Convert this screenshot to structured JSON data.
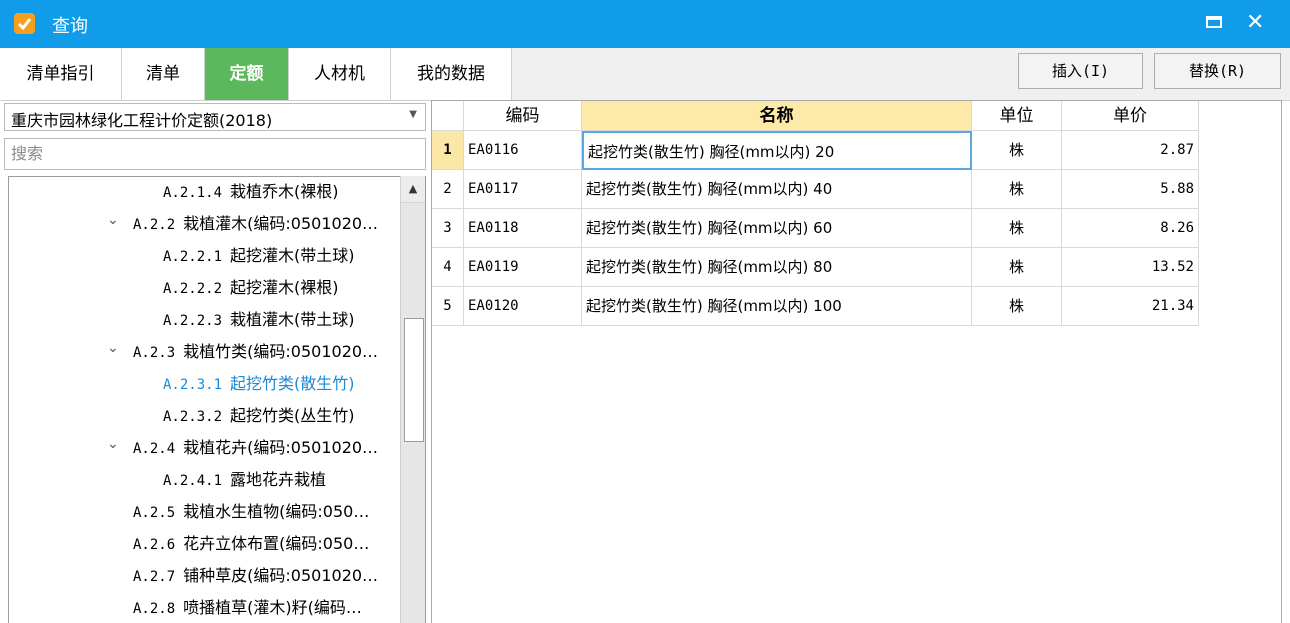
{
  "window": {
    "title": "查询"
  },
  "tabs": [
    {
      "label": "清单指引",
      "active": false
    },
    {
      "label": "清单",
      "active": false
    },
    {
      "label": "定额",
      "active": true
    },
    {
      "label": "人材机",
      "active": false
    },
    {
      "label": "我的数据",
      "active": false
    }
  ],
  "buttons": {
    "insert": "插入(I)",
    "replace": "替换(R)"
  },
  "left": {
    "library_select": "重庆市园林绿化工程计价定额(2018)",
    "search_placeholder": "搜索",
    "tree": [
      {
        "code": "A.2.1.4",
        "label": "栽植乔木(裸根)",
        "level": 3,
        "expanded": null,
        "selected": false
      },
      {
        "code": "A.2.2",
        "label": "栽植灌木(编码:0501020…",
        "level": 2,
        "expanded": true,
        "selected": false
      },
      {
        "code": "A.2.2.1",
        "label": "起挖灌木(带土球)",
        "level": 3,
        "expanded": null,
        "selected": false
      },
      {
        "code": "A.2.2.2",
        "label": "起挖灌木(裸根)",
        "level": 3,
        "expanded": null,
        "selected": false
      },
      {
        "code": "A.2.2.3",
        "label": "栽植灌木(带土球)",
        "level": 3,
        "expanded": null,
        "selected": false
      },
      {
        "code": "A.2.3",
        "label": "栽植竹类(编码:0501020…",
        "level": 2,
        "expanded": true,
        "selected": false
      },
      {
        "code": "A.2.3.1",
        "label": "起挖竹类(散生竹)",
        "level": 3,
        "expanded": null,
        "selected": true
      },
      {
        "code": "A.2.3.2",
        "label": "起挖竹类(丛生竹)",
        "level": 3,
        "expanded": null,
        "selected": false
      },
      {
        "code": "A.2.4",
        "label": "栽植花卉(编码:0501020…",
        "level": 2,
        "expanded": true,
        "selected": false
      },
      {
        "code": "A.2.4.1",
        "label": "露地花卉栽植",
        "level": 3,
        "expanded": null,
        "selected": false
      },
      {
        "code": "A.2.5",
        "label": "栽植水生植物(编码:050…",
        "level": 2,
        "expanded": null,
        "selected": false
      },
      {
        "code": "A.2.6",
        "label": "花卉立体布置(编码:050…",
        "level": 2,
        "expanded": null,
        "selected": false
      },
      {
        "code": "A.2.7",
        "label": "铺种草皮(编码:0501020…",
        "level": 2,
        "expanded": null,
        "selected": false
      },
      {
        "code": "A.2.8",
        "label": "喷播植草(灌木)籽(编码…",
        "level": 2,
        "expanded": null,
        "selected": false
      }
    ]
  },
  "grid": {
    "columns": {
      "code": "编码",
      "name": "名称",
      "unit": "单位",
      "price": "单价"
    },
    "rows": [
      {
        "num": "1",
        "code": "EA0116",
        "name": "起挖竹类(散生竹) 胸径(mm以内) 20",
        "unit": "株",
        "price": "2.87"
      },
      {
        "num": "2",
        "code": "EA0117",
        "name": "起挖竹类(散生竹) 胸径(mm以内) 40",
        "unit": "株",
        "price": "5.88"
      },
      {
        "num": "3",
        "code": "EA0118",
        "name": "起挖竹类(散生竹) 胸径(mm以内) 60",
        "unit": "株",
        "price": "8.26"
      },
      {
        "num": "4",
        "code": "EA0119",
        "name": "起挖竹类(散生竹) 胸径(mm以内) 80",
        "unit": "株",
        "price": "13.52"
      },
      {
        "num": "5",
        "code": "EA0120",
        "name": "起挖竹类(散生竹) 胸径(mm以内) 100",
        "unit": "株",
        "price": "21.34"
      }
    ]
  },
  "colors": {
    "titlebar": "#109ce9",
    "active_tab": "#5cb85c",
    "selected_tree": "#1a8ad8",
    "header_highlight": "#fde9a8"
  }
}
